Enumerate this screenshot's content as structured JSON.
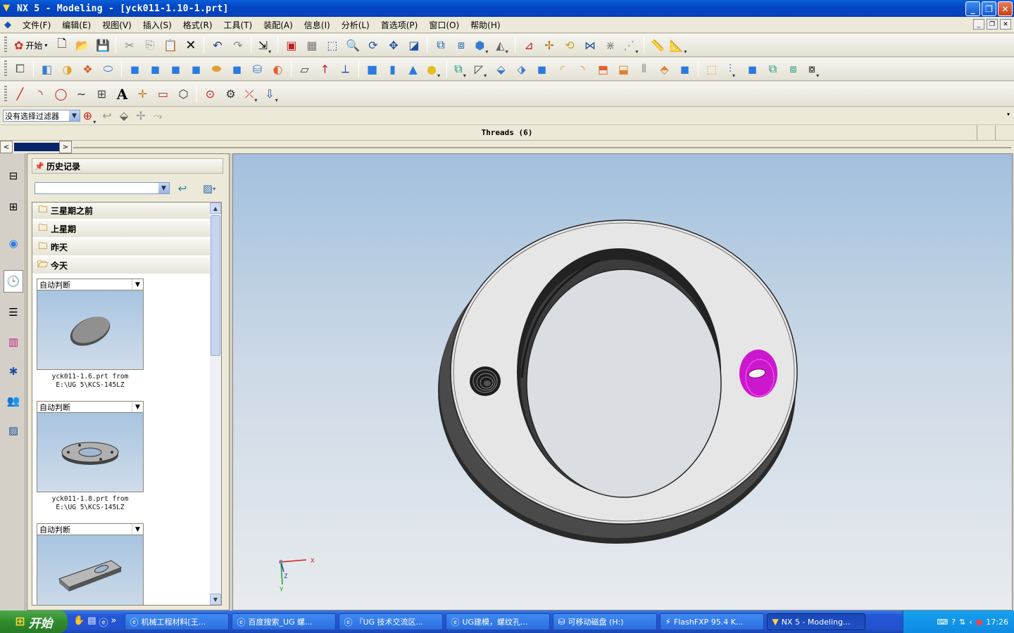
{
  "window": {
    "title": "NX 5 - Modeling - [yck011-1.10-1.prt]"
  },
  "menu": [
    "文件(F)",
    "编辑(E)",
    "视图(V)",
    "插入(S)",
    "格式(R)",
    "工具(T)",
    "装配(A)",
    "信息(I)",
    "分析(L)",
    "首选项(P)",
    "窗口(O)",
    "帮助(H)"
  ],
  "toolbar": {
    "start_label": "开始"
  },
  "filter": {
    "value": "没有选择过滤器"
  },
  "cue_line": "Threads (6)",
  "panel": {
    "title": "历史记录",
    "groups": [
      "三星期之前",
      "上星期",
      "昨天",
      "今天"
    ],
    "cards": [
      {
        "mode": "自动判断",
        "caption1": "yck011-1.6.prt from",
        "caption2": "E:\\UG 5\\KCS-145LZ"
      },
      {
        "mode": "自动判断",
        "caption1": "yck011-1.8.prt from",
        "caption2": "E:\\UG 5\\KCS-145LZ"
      },
      {
        "mode": "自动判断",
        "caption1": "",
        "caption2": ""
      }
    ]
  },
  "axes": {
    "x": "X",
    "y": "Y",
    "z": "Z"
  },
  "taskbar": {
    "start": "开始",
    "tasks": [
      "机械工程材料[王...",
      "百度搜索_UG 螺...",
      "『UG 技术交流区...",
      "UG建模，螺纹孔...",
      "可移动磁盘 (H:)",
      "FlashFXP 95.4 K...",
      "NX 5 - Modeling..."
    ],
    "clock": "17:26"
  },
  "colors": {
    "selected_feature": "#cc18cc",
    "title_bar": "#0a5fd8"
  }
}
